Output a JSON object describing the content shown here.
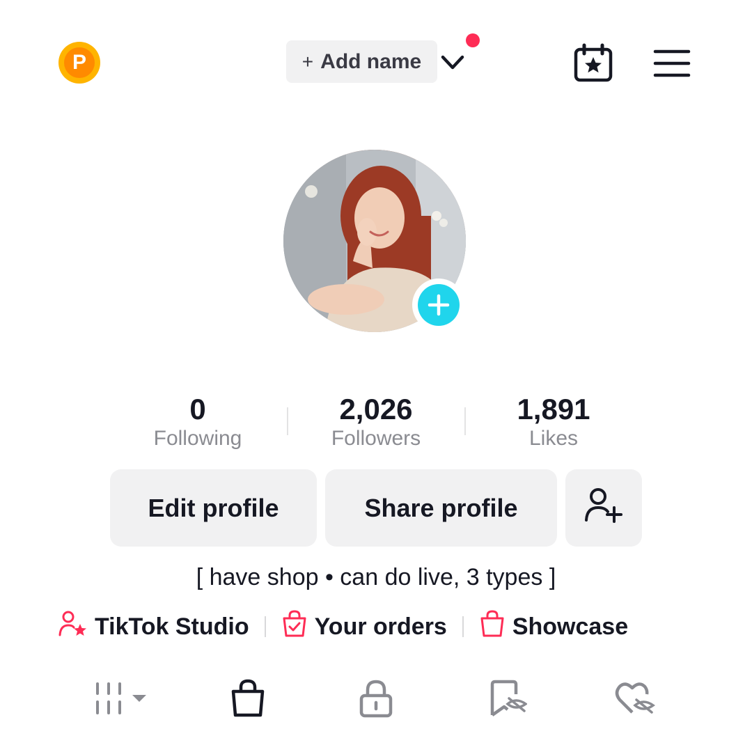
{
  "topbar": {
    "coin_letter": "P",
    "add_name_plus": "+",
    "add_name_label": "Add name",
    "icons": [
      "coin-icon",
      "chevron-down-icon",
      "notification-dot",
      "calendar-star-icon",
      "menu-icon"
    ]
  },
  "profile": {
    "avatar_icon": "avatar-photo",
    "add_avatar_icon": "plus-icon"
  },
  "stats": [
    {
      "value": "0",
      "label": "Following"
    },
    {
      "value": "2,026",
      "label": "Followers"
    },
    {
      "value": "1,891",
      "label": "Likes"
    }
  ],
  "buttons": {
    "edit": "Edit profile",
    "share": "Share profile",
    "add_friend_icon": "add-user-icon"
  },
  "bio": "[ have shop • can do live, 3 types ]",
  "links": [
    {
      "label": "TikTok Studio",
      "icon": "creator-star-icon"
    },
    {
      "label": "Your orders",
      "icon": "orders-bag-icon"
    },
    {
      "label": "Showcase",
      "icon": "shopping-bag-icon"
    }
  ],
  "tabs": [
    "grid-videos-icon",
    "shop-bag-icon",
    "lock-icon",
    "favorites-hidden-icon",
    "liked-hidden-icon"
  ],
  "colors": {
    "accent_red": "#fe2c55",
    "add_avatar": "#20d5ec",
    "coin": "#ffb400",
    "button_bg": "#f1f1f2"
  }
}
